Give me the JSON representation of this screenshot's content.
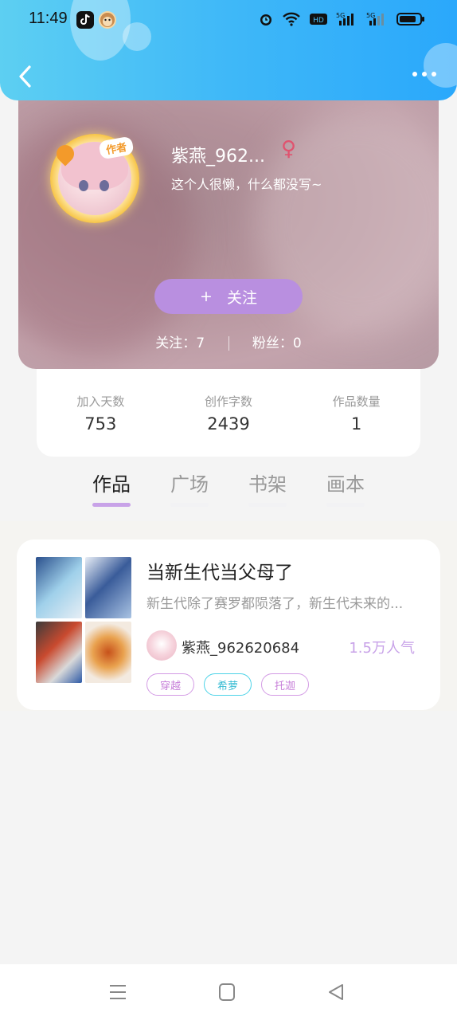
{
  "status_bar": {
    "time": "11:49",
    "icons": [
      "tiktok-icon",
      "monkey-app-icon",
      "alarm-icon",
      "wifi-icon",
      "hd-icon",
      "signal-5g-icon",
      "signal-5g-icon",
      "battery-icon"
    ],
    "network_label_1": "5G",
    "network_label_2": "5G",
    "hd_label": "HD"
  },
  "header": {
    "back_icon": "chevron-left-icon",
    "more_icon": "more-dots-icon"
  },
  "profile": {
    "author_badge": "作者",
    "nickname": "紫燕_962...",
    "gender_symbol": "♀",
    "bio": "这个人很懒，什么都没写~",
    "follow_button": {
      "plus": "+",
      "label": "关注"
    },
    "following_label": "关注：7",
    "followers_label": "粉丝：0"
  },
  "stats": [
    {
      "label": "加入天数",
      "value": "753"
    },
    {
      "label": "创作字数",
      "value": "2439"
    },
    {
      "label": "作品数量",
      "value": "1"
    }
  ],
  "tabs": [
    {
      "label": "作品",
      "active": true
    },
    {
      "label": "广场",
      "active": false
    },
    {
      "label": "书架",
      "active": false
    },
    {
      "label": "画本",
      "active": false
    }
  ],
  "works": [
    {
      "title": "当新生代当父母了",
      "description": "新生代除了赛罗都陨落了，新生代未来的...",
      "author": "紫燕_962620684",
      "popularity": "1.5万人气",
      "tags": [
        "穿越",
        "希萝",
        "托迦"
      ]
    }
  ],
  "nav_bar": {
    "menu_icon": "menu-icon",
    "home_icon": "home-square-icon",
    "back_icon": "back-triangle-icon"
  },
  "colors": {
    "header_gradient_start": "#5dcff2",
    "header_gradient_end": "#2aa8fb",
    "accent_purple": "#c8a2e8",
    "follow_button": "#b98fe0",
    "gender_pink": "#e0536f",
    "tag_cyan": "#38bcd3"
  }
}
